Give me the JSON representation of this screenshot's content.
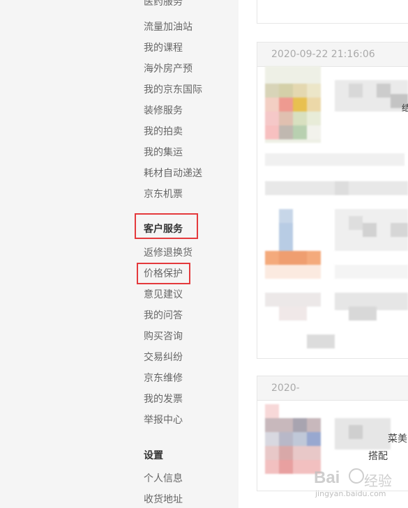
{
  "sidebar": {
    "top_partial": "医药服务",
    "group1": [
      "流量加油站",
      "我的课程",
      "海外房产预",
      "我的京东国际",
      "装修服务",
      "我的拍卖",
      "我的集运",
      "耗材自动递送",
      "京东机票"
    ],
    "service_heading": "客户服务",
    "service_items": [
      "返修退换货",
      "价格保护",
      "意见建议",
      "我的问答",
      "购买咨询",
      "交易纠纷",
      "京东维修",
      "我的发票",
      "举报中心"
    ],
    "settings_heading": "设置",
    "settings_items": [
      "个人信息",
      "收货地址"
    ]
  },
  "orders": [
    {
      "date": "2020-09-22 21:16:06",
      "fragment": "结"
    },
    {
      "date": "2020-",
      "fragment_1": "菜美",
      "fragment_2": "搭配"
    }
  ],
  "watermark": {
    "brand": "Bai",
    "brand_cn": "经验",
    "url": "jingyan.baidu.com"
  },
  "colors": {
    "highlight": "#e4393c"
  }
}
